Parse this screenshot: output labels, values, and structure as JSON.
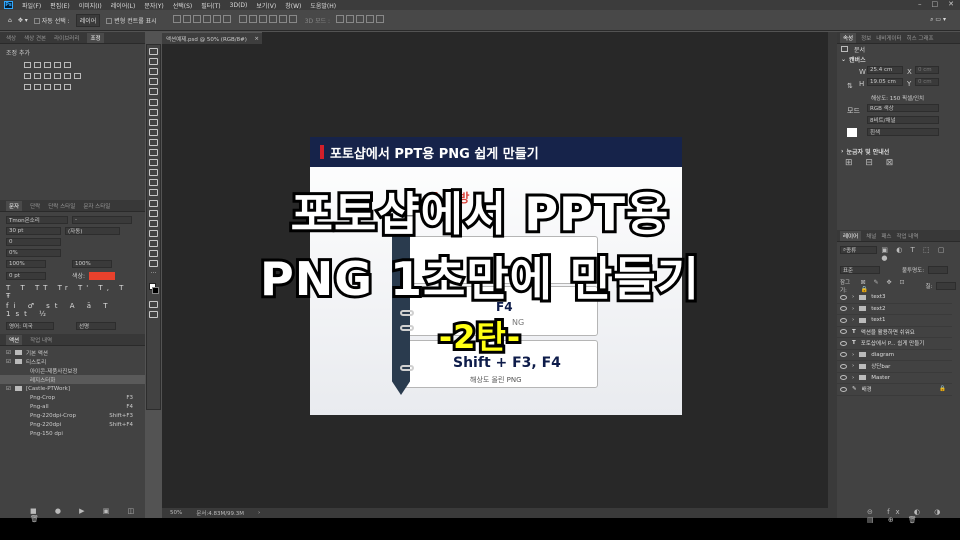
{
  "menubar": {
    "items": [
      "파일(F)",
      "편집(E)",
      "이미지(I)",
      "레이어(L)",
      "문자(Y)",
      "선택(S)",
      "필터(T)",
      "3D(D)",
      "보기(V)",
      "창(W)",
      "도움말(H)"
    ]
  },
  "optionsbar": {
    "auto_select_label": "자동 선택 :",
    "auto_select_value": "레이어",
    "transform_label": "변형 컨트롤 표시",
    "mode_3d": "3D 모드 :"
  },
  "left_panel": {
    "top_tabs": [
      "색상",
      "색상 견본",
      "라이브러리",
      "조정"
    ],
    "adjust_title": "조정 추가",
    "char_tabs": [
      "문자",
      "단락",
      "단락 스타일",
      "문자 스타일"
    ],
    "font_family": "Tmon몬소리",
    "font_style": "-",
    "font_size": "30 pt",
    "leading": "(자동)",
    "kerning": "0",
    "tracking": "0%",
    "vscale": "100%",
    "hscale": "100%",
    "baseline": "0 pt",
    "color_label": "색상:",
    "color_value": "#e8412c",
    "language": "영어: 미국",
    "aa_label": "선명",
    "actions_tabs": [
      "액션",
      "작업 내역"
    ],
    "actions": [
      {
        "name": "기본 액션",
        "key": "",
        "level": 0
      },
      {
        "name": "티스토리",
        "key": "",
        "level": 0
      },
      {
        "name": "아이콘-제품사진보정",
        "key": "",
        "level": 1
      },
      {
        "name": "레지스터화",
        "key": "",
        "level": 1
      },
      {
        "name": "[Castle-PTWork]",
        "key": "",
        "level": 0
      },
      {
        "name": "Png-Crop",
        "key": "F3",
        "level": 1
      },
      {
        "name": "Png-all",
        "key": "F4",
        "level": 1
      },
      {
        "name": "Png-220dpi-Crop",
        "key": "Shift+F3",
        "level": 1
      },
      {
        "name": "Png-220dpi",
        "key": "Shift+F4",
        "level": 1
      },
      {
        "name": "Png-150 dpi",
        "key": "",
        "level": 1
      }
    ]
  },
  "document": {
    "tab_title": "액션예제.psd @ 50% (RGB/8#)",
    "zoom": "50%",
    "doc_size": "문서:4.83M/99.3M"
  },
  "canvas": {
    "header": "포토샵에서 PPT용 PNG 쉽게 만들기",
    "card_title": "F4",
    "card_sub": "NG",
    "card2_title": "Shift + F3, F4",
    "card2_sub": "해상도 올린 PNG",
    "partial_red": "를 활 방 쉬"
  },
  "overlay": {
    "line1": "포토샵에서 PPT용",
    "line2": "PNG 1초만에 만들기",
    "line3": "-2탄-"
  },
  "right_panel": {
    "prop_tabs": [
      "속성",
      "정보",
      "내비게이터",
      "히스 그래프"
    ],
    "doc_label": "문서",
    "canvas_section": "캔버스",
    "w_label": "W",
    "w_value": "25.4 cm",
    "h_label": "H",
    "h_value": "19.05 cm",
    "x_label": "X",
    "x_value": "0 cm",
    "y_label": "Y",
    "y_value": "0 cm",
    "resolution": "해상도: 150 픽셀/인치",
    "mode_label": "모드",
    "mode_value": "RGB 색상",
    "bit_value": "8비트/채널",
    "fill_value": "흰색",
    "guides_section": "눈금자 및 안내선",
    "layers_tabs": [
      "레이어",
      "채널",
      "패스",
      "작업 내역"
    ],
    "layer_filter": "종류",
    "blend_mode": "표준",
    "opacity": "불투명도:",
    "lock_label": "잠그기:",
    "fill_label": "칠:",
    "layers": [
      {
        "name": "text3",
        "type": "folder"
      },
      {
        "name": "text2",
        "type": "folder"
      },
      {
        "name": "text1",
        "type": "folder"
      },
      {
        "name": "액션을 활용하면 쉬워요",
        "type": "text"
      },
      {
        "name": "포토샵에서 P... 쉽게 만들기",
        "type": "text"
      },
      {
        "name": "diagram",
        "type": "folder"
      },
      {
        "name": "상단bar",
        "type": "folder"
      },
      {
        "name": "Master",
        "type": "folder"
      },
      {
        "name": "배경",
        "type": "bg"
      }
    ]
  }
}
